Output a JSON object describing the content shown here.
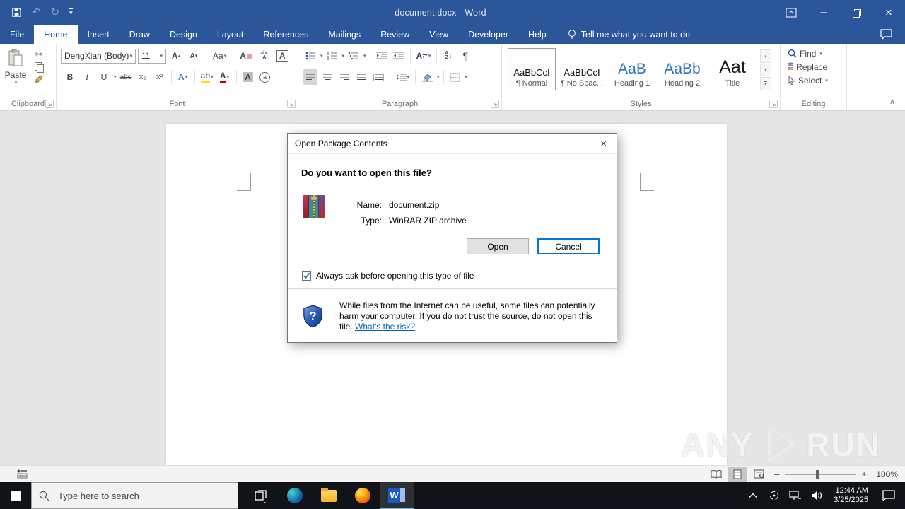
{
  "titlebar": {
    "title": "document.docx  -  Word"
  },
  "tabs": {
    "items": [
      "File",
      "Home",
      "Insert",
      "Draw",
      "Design",
      "Layout",
      "References",
      "Mailings",
      "Review",
      "View",
      "Developer",
      "Help"
    ]
  },
  "tellme": "Tell me what you want to do",
  "ribbon": {
    "clipboard": {
      "group": "Clipboard",
      "paste": "Paste"
    },
    "font": {
      "group": "Font",
      "font_name": "DengXian (Body)",
      "font_size": "11"
    },
    "paragraph": {
      "group": "Paragraph"
    },
    "styles": {
      "group": "Styles",
      "items": [
        {
          "preview": "AaBbCcI",
          "label": "¶ Normal"
        },
        {
          "preview": "AaBbCcI",
          "label": "¶ No Spac..."
        },
        {
          "preview": "AaB",
          "label": "Heading 1"
        },
        {
          "preview": "AaBb",
          "label": "Heading 2"
        },
        {
          "preview": "Aat",
          "label": "Title"
        }
      ]
    },
    "editing": {
      "group": "Editing",
      "find": "Find",
      "replace": "Replace",
      "select": "Select"
    }
  },
  "dialog": {
    "title": "Open Package Contents",
    "heading": "Do you want to open this file?",
    "name_label": "Name:",
    "name_value": "document.zip",
    "type_label": "Type:",
    "type_value": "WinRAR ZIP archive",
    "open_button": "Open",
    "cancel_button": "Cancel",
    "checkbox_label": "Always ask before opening this type of file",
    "warning_text": "While files from the Internet can be useful, some files can potentially harm your computer. If you do not trust the source, do not open this file. ",
    "risk_link": "What's the risk?"
  },
  "statusbar": {
    "zoom_level": "100%",
    "zoom_minus": "–",
    "zoom_plus": "+"
  },
  "taskbar": {
    "search_placeholder": "Type here to search",
    "time": "12:44 AM",
    "date": "3/25/2025"
  },
  "watermark": {
    "left": "ANY",
    "right": "RUN"
  },
  "glyphs": {
    "menu_arrow": "▾",
    "undo": "↶",
    "redo": "↻",
    "close": "×",
    "minimize": "–",
    "scissors": "✂",
    "bold": "B",
    "italic": "I",
    "underline": "U",
    "strikethrough": "abc",
    "subscript": "x₂",
    "superscript": "x²",
    "grow_font": "A",
    "shrink_font": "A",
    "change_case": "Aa",
    "clear_formatting": "A",
    "phonetic_top": "abc",
    "phonetic_bottom": "A",
    "char_border": "A",
    "text_effects": "A",
    "highlight": "ab",
    "font_color": "A",
    "char_shading": "A",
    "enclose": "a",
    "asian_layout": "A",
    "swap_arrows": "⇄",
    "sort_top": "A",
    "sort_bottom": "Z",
    "sort_arrow": "↓",
    "pilcrow": "¶",
    "updown_arrow": "↕",
    "replace_top": "ab",
    "replace_bottom": "ac",
    "collapse_chevron": "∧",
    "styles_up": "▴",
    "styles_down": "▾",
    "styles_more": "▾",
    "launcher": "↘",
    "word_logo": "W"
  },
  "colors": {
    "word_blue": "#2b579a",
    "cancel_focus": "#0078d7",
    "taskbar_bg": "#101419",
    "highlight_yellow": "#ffe400",
    "font_color_red": "#c00000",
    "link_blue": "#0063b1"
  }
}
